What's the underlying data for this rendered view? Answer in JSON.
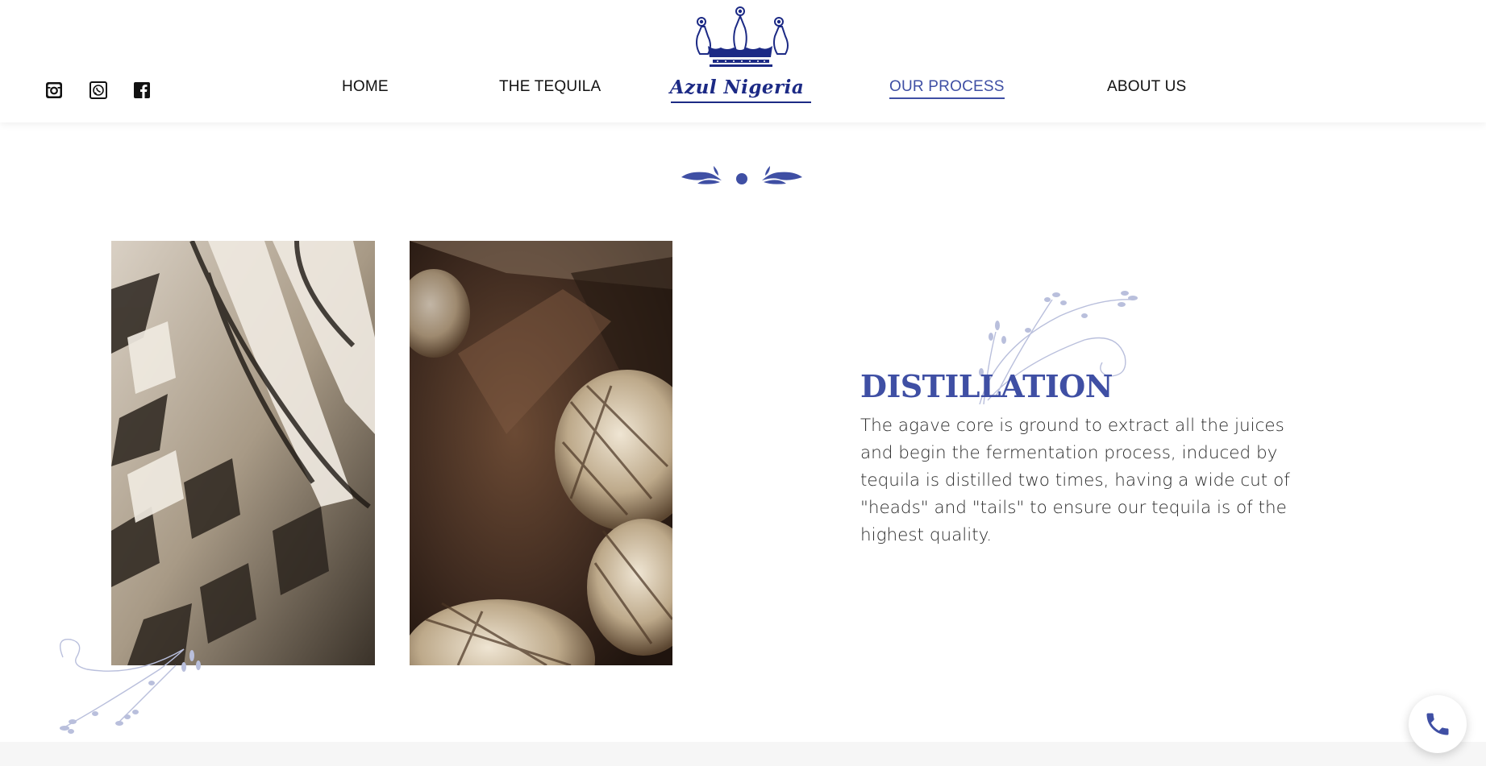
{
  "header": {
    "social": [
      "instagram-icon",
      "whatsapp-icon",
      "facebook-icon"
    ],
    "nav": [
      {
        "label": "HOME",
        "active": false
      },
      {
        "label": "THE TEQUILA",
        "active": false
      },
      {
        "label": "OUR PROCESS",
        "active": true
      },
      {
        "label": "ABOUT US",
        "active": false
      }
    ],
    "logo_text": "Azul Nigeria"
  },
  "section": {
    "title": "DISTILLATION",
    "body": "The agave core is ground to extract all the juices and begin the fermentation process, induced by tequila is distilled two times, having a wide cut of \"heads\" and \"tails\" to ensure our tequila is of the highest quality."
  },
  "images": [
    {
      "name": "agave-fiber-photo"
    },
    {
      "name": "agave-pinas-photo"
    }
  ],
  "floating": {
    "icon": "phone-icon"
  },
  "colors": {
    "accent": "#3f4fa4",
    "logo": "#1c2a85",
    "flourish": "#b9bfdc"
  }
}
